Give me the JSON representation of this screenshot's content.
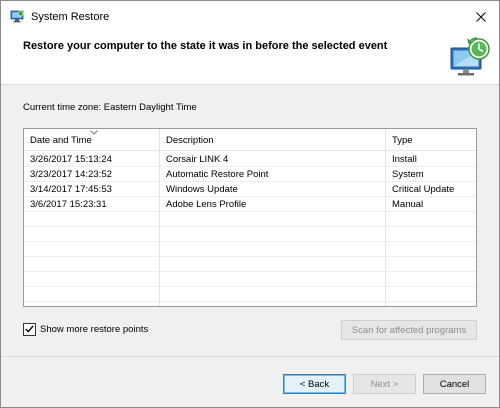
{
  "window": {
    "title": "System Restore"
  },
  "header": {
    "title": "Restore your computer to the state it was in before the selected event"
  },
  "timezone": "Current time zone: Eastern Daylight Time",
  "table": {
    "columns": [
      "Date and Time",
      "Description",
      "Type"
    ],
    "rows": [
      {
        "date": "3/26/2017 15:13:24",
        "description": "Corsair LINK 4",
        "type": "Install"
      },
      {
        "date": "3/23/2017 14:23:52",
        "description": "Automatic Restore Point",
        "type": "System"
      },
      {
        "date": "3/14/2017 17:45:53",
        "description": "Windows Update",
        "type": "Critical Update"
      },
      {
        "date": "3/6/2017 15:23:31",
        "description": "Adobe Lens Profile",
        "type": "Manual"
      }
    ]
  },
  "options": {
    "show_more_label": "Show more restore points",
    "show_more_checked": true
  },
  "buttons": {
    "scan": "Scan for affected programs",
    "back": "< Back",
    "next": "Next >",
    "cancel": "Cancel"
  }
}
